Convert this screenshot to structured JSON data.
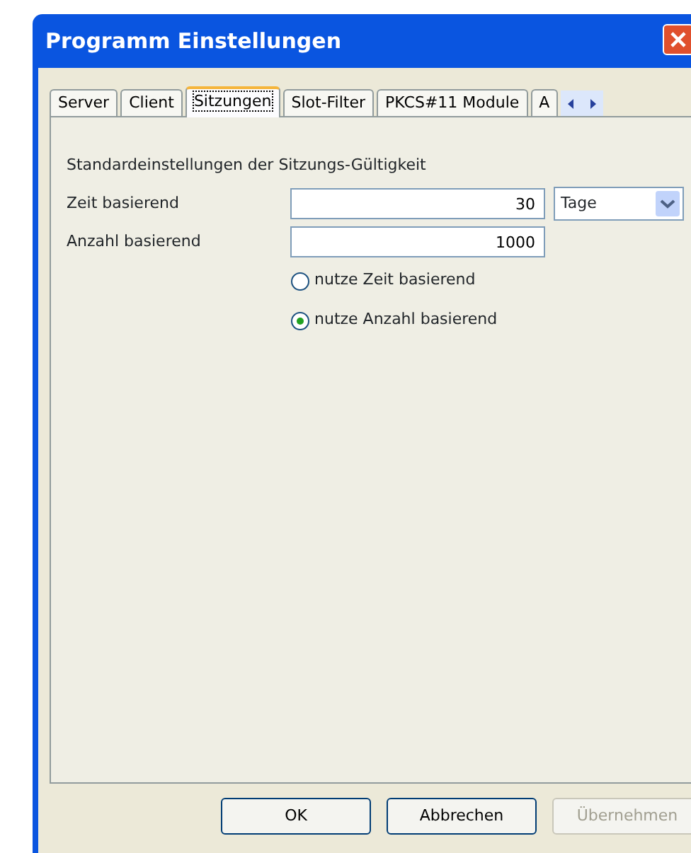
{
  "window": {
    "title": "Programm Einstellungen"
  },
  "tabs": [
    {
      "label": "Server",
      "selected": false
    },
    {
      "label": "Client",
      "selected": false
    },
    {
      "label": "Sitzungen",
      "selected": true
    },
    {
      "label": "Slot-Filter",
      "selected": false
    },
    {
      "label": "PKCS#11 Module",
      "selected": false
    },
    {
      "label": "A",
      "selected": false
    }
  ],
  "section_heading": "Standardeinstellungen der Sitzungs-Gültigkeit",
  "fields": [
    {
      "label": "Zeit basierend",
      "value": "30",
      "unit": "Tage"
    },
    {
      "label": "Anzahl basierend",
      "value": "1000"
    }
  ],
  "options": [
    {
      "label": "nutze Zeit basierend",
      "selected": false
    },
    {
      "label": "nutze Anzahl basierend",
      "selected": true
    }
  ],
  "buttons": [
    {
      "label": "OK",
      "disabled": false
    },
    {
      "label": "Abbrechen",
      "disabled": false
    },
    {
      "label": "Übernehmen",
      "disabled": true
    }
  ]
}
